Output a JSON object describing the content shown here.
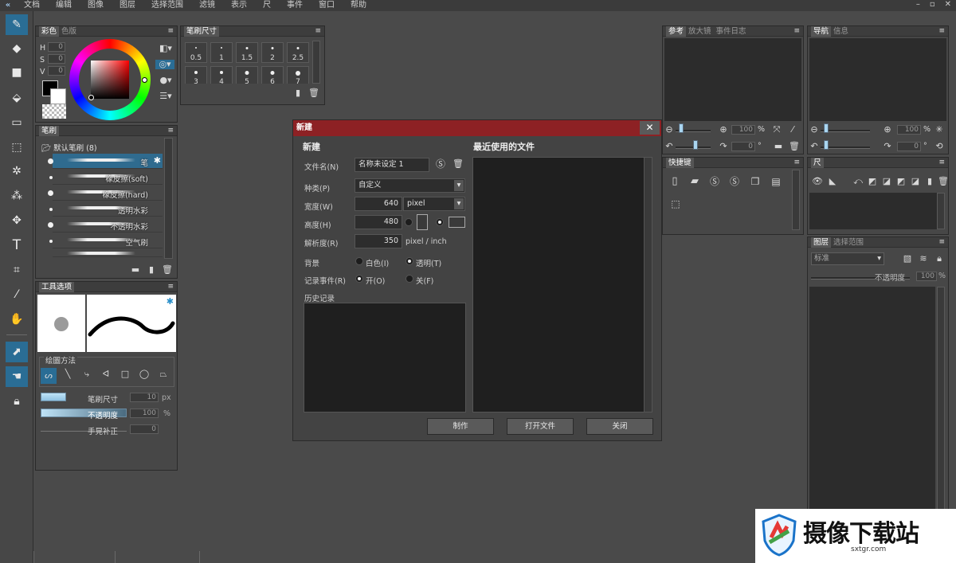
{
  "menubar": {
    "items": [
      "文档",
      "编辑",
      "图像",
      "图层",
      "选择范围",
      "滤镜",
      "表示",
      "尺",
      "事件",
      "窗口",
      "帮助"
    ],
    "window_controls": [
      "–",
      "▫",
      "✕"
    ]
  },
  "color_panel": {
    "tabs": [
      "彩色",
      "色版"
    ],
    "h_label": "H",
    "h_value": "0",
    "s_label": "S",
    "s_value": "0",
    "v_label": "V",
    "v_value": "0"
  },
  "brush_size_panel": {
    "title": "笔刷尺寸",
    "sizes": [
      "0.5",
      "1",
      "1.5",
      "2",
      "2.5",
      "3",
      "4",
      "5",
      "6",
      "7"
    ]
  },
  "brush_panel": {
    "title": "笔刷",
    "group": "默认笔刷 (8)",
    "brushes": [
      "笔",
      "橡皮擦(soft)",
      "橡皮擦(hard)",
      "透明水彩",
      "不透明水彩",
      "空气刷",
      ""
    ]
  },
  "tool_options": {
    "title": "工具选项",
    "draw_method_label": "绘圖方法",
    "brush_size_label": "笔刷尺寸",
    "brush_size_value": "10",
    "brush_size_unit": "px",
    "opacity_label": "不透明度",
    "opacity_value": "100",
    "opacity_unit": "%",
    "stabilizer_label": "手晃补正",
    "stabilizer_value": "0"
  },
  "reference_panel": {
    "tabs": [
      "参考",
      "放大镜",
      "事件日志"
    ],
    "zoom_value": "100",
    "zoom_unit": "%",
    "rotate_value": "0",
    "rotate_unit": "°"
  },
  "navigator_panel": {
    "tabs": [
      "导航",
      "信息"
    ],
    "zoom_value": "100",
    "zoom_unit": "%",
    "rotate_value": "0",
    "rotate_unit": "°"
  },
  "shortcut_panel": {
    "title": "快捷键"
  },
  "ruler_panel": {
    "title": "尺"
  },
  "layer_panel": {
    "tabs": [
      "图层",
      "选择范围"
    ],
    "blend_mode": "标准",
    "opacity_label": "不透明度",
    "opacity_value": "100",
    "opacity_unit": "%"
  },
  "new_dialog": {
    "title": "新建",
    "section_new": "新建",
    "section_recent": "最近使用的文件",
    "filename_label": "文件名(N)",
    "filename_value": "名称未设定 1",
    "type_label": "种类(P)",
    "type_value": "自定义",
    "width_label": "宽度(W)",
    "width_value": "640",
    "width_unit": "pixel",
    "height_label": "高度(H)",
    "height_value": "480",
    "resolution_label": "解析度(R)",
    "resolution_value": "350",
    "resolution_unit": "pixel / inch",
    "background_label": "背景",
    "bg_white": "白色(I)",
    "bg_transparent": "透明(T)",
    "record_label": "记录事件(R)",
    "record_on": "开(O)",
    "record_off": "关(F)",
    "history_label": "历史记录",
    "btn_create": "制作",
    "btn_open": "打开文件",
    "btn_close": "关闭",
    "selected_background": "透明(T)",
    "selected_record": "开(O)"
  },
  "watermark": {
    "title": "摄像下载站",
    "url": "sxtgr.com"
  },
  "colors": {
    "accent": "#2a6d95",
    "dialog_title": "#8d2124",
    "background": "#4a4a4a"
  }
}
